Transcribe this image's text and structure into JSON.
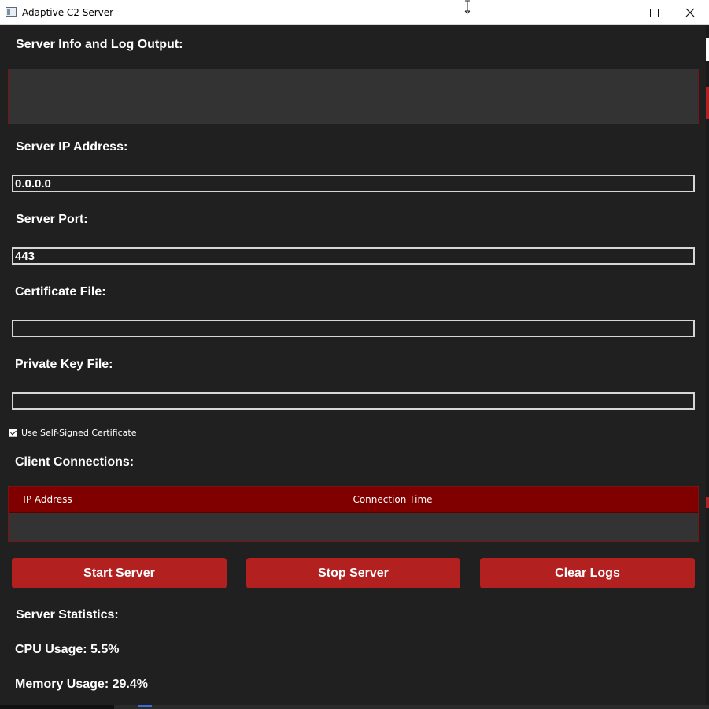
{
  "window": {
    "title": "Adaptive C2 Server",
    "controls": {
      "minimize": "minimize-icon",
      "maximize": "maximize-icon",
      "close": "close-icon"
    }
  },
  "log": {
    "label": "Server Info and Log Output:",
    "content": ""
  },
  "server_ip": {
    "label": "Server IP Address:",
    "value": "0.0.0.0"
  },
  "server_port": {
    "label": "Server Port:",
    "value": "443"
  },
  "certificate": {
    "label": "Certificate File:",
    "value": ""
  },
  "private_key": {
    "label": "Private Key File:",
    "value": ""
  },
  "self_signed": {
    "label": "Use Self-Signed Certificate",
    "checked": true
  },
  "clients": {
    "label": "Client Connections:",
    "columns": [
      "IP Address",
      "Connection Time"
    ],
    "rows": []
  },
  "buttons": {
    "start": "Start Server",
    "stop": "Stop Server",
    "clear": "Clear Logs"
  },
  "stats": {
    "label": "Server Statistics:",
    "cpu": "CPU Usage: 5.5%",
    "memory": "Memory Usage: 29.4%"
  },
  "colors": {
    "background": "#202020",
    "accent": "#b22020",
    "table_header": "#800000",
    "panel": "#333333"
  }
}
